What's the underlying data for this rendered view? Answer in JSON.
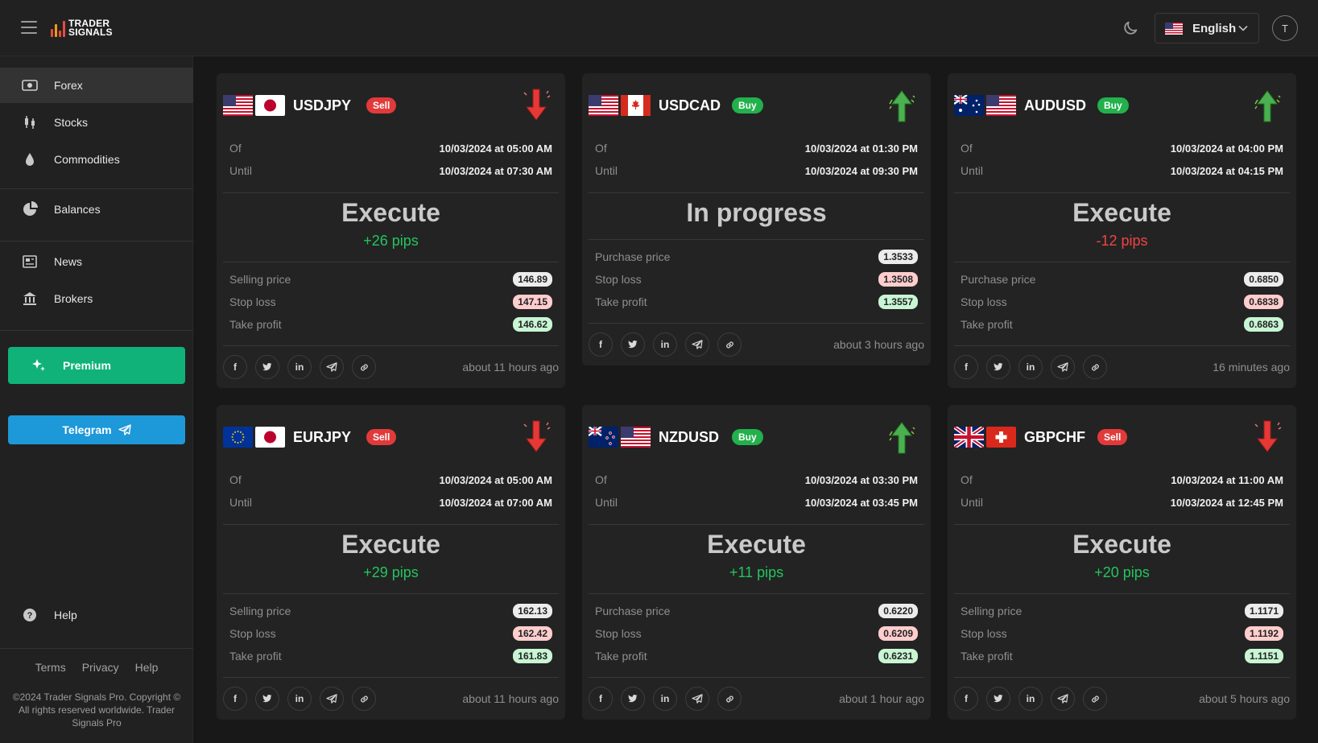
{
  "header": {
    "logo_line1": "TRADER",
    "logo_line2": "SIGNALS",
    "language": "English"
  },
  "user": {
    "initial": "T"
  },
  "sidebar": {
    "items": [
      {
        "label": "Forex",
        "icon": "banknote-icon",
        "active": true
      },
      {
        "label": "Stocks",
        "icon": "candlestick-icon"
      },
      {
        "label": "Commodities",
        "icon": "droplet-icon"
      },
      {
        "label": "Balances",
        "icon": "pie-chart-icon"
      },
      {
        "label": "News",
        "icon": "newspaper-icon"
      },
      {
        "label": "Brokers",
        "icon": "bank-icon"
      }
    ],
    "premium_label": "Premium",
    "telegram_label": "Telegram",
    "help_label": "Help",
    "footer_links": [
      "Terms",
      "Privacy",
      "Help"
    ],
    "copyright": "©2024 Trader Signals Pro. Copyright © All rights reserved worldwide. Trader Signals Pro"
  },
  "colors": {
    "accent_green": "#10b27a",
    "telegram_blue": "#1d98d8",
    "sell_red": "#e23a3a",
    "buy_green": "#22b14c"
  },
  "labels": {
    "of": "Of",
    "until": "Until",
    "selling_price": "Selling price",
    "purchase_price": "Purchase price",
    "stop_loss": "Stop loss",
    "take_profit": "Take profit"
  },
  "signals": [
    {
      "pair": "USDJPY",
      "side": "Sell",
      "flags": [
        "us",
        "jp"
      ],
      "of": "10/03/2024 at 05:00 AM",
      "until": "10/03/2024 at 07:30 AM",
      "status": "Execute",
      "pips": "+26 pips",
      "price_label": "Selling price",
      "price": "146.89",
      "stop_loss": "147.15",
      "take_profit": "146.62",
      "ago": "about 11 hours ago"
    },
    {
      "pair": "USDCAD",
      "side": "Buy",
      "flags": [
        "us",
        "ca"
      ],
      "of": "10/03/2024 at 01:30 PM",
      "until": "10/03/2024 at 09:30 PM",
      "status": "In progress",
      "pips": "",
      "price_label": "Purchase price",
      "price": "1.3533",
      "stop_loss": "1.3508",
      "take_profit": "1.3557",
      "ago": "about 3 hours ago"
    },
    {
      "pair": "AUDUSD",
      "side": "Buy",
      "flags": [
        "au",
        "us"
      ],
      "of": "10/03/2024 at 04:00 PM",
      "until": "10/03/2024 at 04:15 PM",
      "status": "Execute",
      "pips": "-12 pips",
      "price_label": "Purchase price",
      "price": "0.6850",
      "stop_loss": "0.6838",
      "take_profit": "0.6863",
      "ago": "16 minutes ago"
    },
    {
      "pair": "EURJPY",
      "side": "Sell",
      "flags": [
        "eu",
        "jp"
      ],
      "of": "10/03/2024 at 05:00 AM",
      "until": "10/03/2024 at 07:00 AM",
      "status": "Execute",
      "pips": "+29 pips",
      "price_label": "Selling price",
      "price": "162.13",
      "stop_loss": "162.42",
      "take_profit": "161.83",
      "ago": "about 11 hours ago"
    },
    {
      "pair": "NZDUSD",
      "side": "Buy",
      "flags": [
        "nz",
        "us"
      ],
      "of": "10/03/2024 at 03:30 PM",
      "until": "10/03/2024 at 03:45 PM",
      "status": "Execute",
      "pips": "+11 pips",
      "price_label": "Purchase price",
      "price": "0.6220",
      "stop_loss": "0.6209",
      "take_profit": "0.6231",
      "ago": "about 1 hour ago"
    },
    {
      "pair": "GBPCHF",
      "side": "Sell",
      "flags": [
        "gb",
        "ch"
      ],
      "of": "10/03/2024 at 11:00 AM",
      "until": "10/03/2024 at 12:45 PM",
      "status": "Execute",
      "pips": "+20 pips",
      "price_label": "Selling price",
      "price": "1.1171",
      "stop_loss": "1.1192",
      "take_profit": "1.1151",
      "ago": "about 5 hours ago"
    }
  ],
  "share_icons": [
    "facebook-icon",
    "twitter-icon",
    "linkedin-icon",
    "telegram-icon",
    "link-icon"
  ]
}
